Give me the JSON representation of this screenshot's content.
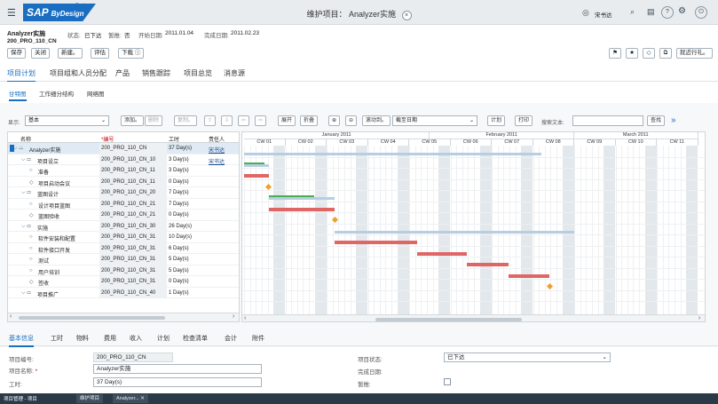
{
  "shell": {
    "logo_main": "SAP",
    "logo_sub": "ByDesign",
    "logo_super": "Business",
    "title": "维护项目： Analyzer实施",
    "user": "宋书达",
    "icons": [
      "menu-icon",
      "close-icon",
      "user-icon",
      "search-icon",
      "notes-icon",
      "help-icon",
      "settings-icon",
      "power-icon"
    ]
  },
  "header": {
    "project_name": "Analyzer实施",
    "project_id": "200_PRO_110_CN",
    "status_label": "状态:",
    "status_value": "已下达",
    "blocked_label": "暂推:",
    "blocked_value": "否",
    "start_label": "开始日期:",
    "start_value": "2011.01.04",
    "end_label": "完成日期:",
    "end_value": "2011.02.23",
    "buttons": [
      "保存",
      "关闭",
      "新建。",
      "评估",
      "下载"
    ],
    "right_button": "就近行礼。"
  },
  "tabs": [
    "项目计划",
    "项目组和人员分配",
    "产品",
    "销售跟踪",
    "项目总览",
    "消息源"
  ],
  "subtabs": [
    "甘特图",
    "工作细分结构",
    "网络图"
  ],
  "toolbar": {
    "show_label": "显示:",
    "show_value": "基本",
    "add": "添加。",
    "delete": "删除",
    "copy": "复制。",
    "expand": "展开",
    "collapse": "折叠",
    "scroll": "滚动到。",
    "date_select": "截至日期",
    "plan": "计划",
    "print": "打印",
    "search_label": "搜索文本:",
    "search_value": "",
    "find": "查找"
  },
  "grid": {
    "headers": [
      "名称",
      "*编号",
      "工时",
      "责任人"
    ],
    "rows": [
      {
        "name": "Analyzer实施",
        "id": "200_PRO_110_CN",
        "work": "37 Day(s)",
        "owner": "宋书达",
        "level": 0,
        "kind": "project"
      },
      {
        "name": "项目设立",
        "id": "200_PRO_110_CN_10",
        "work": "3 Day(s)",
        "owner": "宋书达",
        "level": 1,
        "kind": "phase"
      },
      {
        "name": "准备",
        "id": "200_PRO_110_CN_11",
        "work": "3 Day(s)",
        "owner": "",
        "level": 2,
        "kind": "task"
      },
      {
        "name": "项目启动会议",
        "id": "200_PRO_110_CN_11",
        "work": "0 Day(s)",
        "owner": "",
        "level": 2,
        "kind": "milestone"
      },
      {
        "name": "蓝图设计",
        "id": "200_PRO_110_CN_20",
        "work": "7 Day(s)",
        "owner": "",
        "level": 1,
        "kind": "phase"
      },
      {
        "name": "设计项目蓝图",
        "id": "200_PRO_110_CN_21",
        "work": "7 Day(s)",
        "owner": "",
        "level": 2,
        "kind": "task"
      },
      {
        "name": "蓝图验收",
        "id": "200_PRO_110_CN_21",
        "work": "0 Day(s)",
        "owner": "",
        "level": 2,
        "kind": "milestone"
      },
      {
        "name": "实施",
        "id": "200_PRO_110_CN_30",
        "work": "26 Day(s)",
        "owner": "",
        "level": 1,
        "kind": "phase"
      },
      {
        "name": "软件安装和配置",
        "id": "200_PRO_110_CN_31",
        "work": "10 Day(s)",
        "owner": "",
        "level": 2,
        "kind": "task"
      },
      {
        "name": "软件接口开发",
        "id": "200_PRO_110_CN_31",
        "work": "6 Day(s)",
        "owner": "",
        "level": 2,
        "kind": "task"
      },
      {
        "name": "测试",
        "id": "200_PRO_110_CN_31",
        "work": "5 Day(s)",
        "owner": "",
        "level": 2,
        "kind": "task"
      },
      {
        "name": "用户培训",
        "id": "200_PRO_110_CN_31",
        "work": "5 Day(s)",
        "owner": "",
        "level": 2,
        "kind": "task"
      },
      {
        "name": "签收",
        "id": "200_PRO_110_CN_31",
        "work": "0 Day(s)",
        "owner": "",
        "level": 2,
        "kind": "milestone"
      },
      {
        "name": "项目推广",
        "id": "200_PRO_110_CN_40",
        "work": "1 Day(s)",
        "owner": "",
        "level": 1,
        "kind": "phase"
      }
    ]
  },
  "gantt": {
    "months": [
      "January 2011",
      "February 2011",
      "March 2011"
    ],
    "weeks": [
      "CW 01",
      "CW 02",
      "CW 03",
      "CW 04",
      "CW 05",
      "CW 06",
      "CW 07",
      "CW 08",
      "CW 09",
      "CW 10",
      "CW 11"
    ],
    "bars": [
      {
        "row": 0,
        "start": 0.0,
        "end": 7.2,
        "color": "#b7cde3"
      },
      {
        "row": 1,
        "start": 0.0,
        "end": 0.6,
        "color": "#b7cde3"
      },
      {
        "row": 1,
        "start": 0.0,
        "end": 0.5,
        "color": "#4caf50"
      },
      {
        "row": 2,
        "start": 0.0,
        "end": 0.6,
        "color": "#e06666"
      },
      {
        "row": 4,
        "start": 0.6,
        "end": 2.2,
        "color": "#b7cde3"
      },
      {
        "row": 4,
        "start": 0.6,
        "end": 1.7,
        "color": "#4caf50"
      },
      {
        "row": 5,
        "start": 0.6,
        "end": 2.2,
        "color": "#e06666"
      },
      {
        "row": 7,
        "start": 2.2,
        "end": 8.0,
        "color": "#b7cde3"
      },
      {
        "row": 8,
        "start": 2.2,
        "end": 4.2,
        "color": "#e06666"
      },
      {
        "row": 9,
        "start": 4.2,
        "end": 5.4,
        "color": "#e06666"
      },
      {
        "row": 10,
        "start": 5.4,
        "end": 6.4,
        "color": "#e06666"
      },
      {
        "row": 11,
        "start": 6.4,
        "end": 7.4,
        "color": "#e06666"
      }
    ],
    "milestones": [
      3,
      6,
      12
    ]
  },
  "detail_tabs": [
    "基本信息",
    "工时",
    "物料",
    "费用",
    "收入",
    "计划",
    "检查清单",
    "会计",
    "附件"
  ],
  "detail": {
    "proj_id_label": "项目编号:",
    "proj_id": "200_PRO_110_CN",
    "proj_name_label": "项目名称:",
    "proj_name": "Analyzer实施",
    "work_label": "工时:",
    "work": "37 Day(s)",
    "status_label": "项目状态:",
    "status": "已下达",
    "end_label": "完成日期:",
    "end": "",
    "blocked_label": "暂推:"
  },
  "taskbar": {
    "start": "项目管理 - 项目",
    "items": [
      "维护项目",
      "Analyzer..."
    ]
  }
}
